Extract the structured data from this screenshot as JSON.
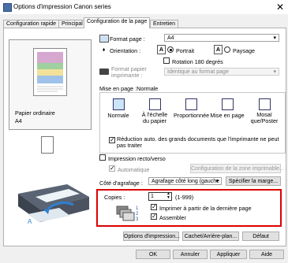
{
  "window": {
    "title": "Options d'impression Canon                          series"
  },
  "tabs": [
    "Configuration rapide",
    "Principal",
    "Configuration de la page",
    "Entretien"
  ],
  "page": {
    "format_page_label": "Format page :",
    "format_page_value": "A4",
    "orientation_label": "Orientation :",
    "portrait": "Portrait",
    "paysage": "Paysage",
    "rotation": "Rotation 180 degrés",
    "format_papier_label": "Format papier imprimante :",
    "format_papier_value": "Identique au format page",
    "mise_en_page_label": "Mise en page :Normale",
    "layouts": [
      "Normale",
      "À l'échelle du papier",
      "Proportionnée",
      "Mise en page",
      "Mosaï que/Poster"
    ],
    "reduction_text": "Réduction auto. des grands documents que l'imprimante ne peut pas traiter",
    "recto_verso": "Impression recto/verso",
    "automatique": "Automatique",
    "config_zone": "Configuration de la zone imprimable...",
    "cote_agrafage_label": "Côté d'agrafage :",
    "cote_agrafage_value": "Agrafage côté long (gauche",
    "specifier_marge": "Spécifier la marge...",
    "copies_label": "Copies :",
    "copies_value": "1",
    "copies_range": "(1-999)",
    "derniere_page": "Imprimer à partir de la dernière page",
    "assembler": "Assembler",
    "options_impression": "Options d'impression...",
    "cachet": "Cachet/Arrière-plan...",
    "defaut": "Défaut"
  },
  "preview": {
    "media": "Papier ordinaire",
    "size": "A4"
  },
  "footer": {
    "ok": "OK",
    "annuler": "Annuler",
    "appliquer": "Appliquer",
    "aide": "Aide"
  }
}
